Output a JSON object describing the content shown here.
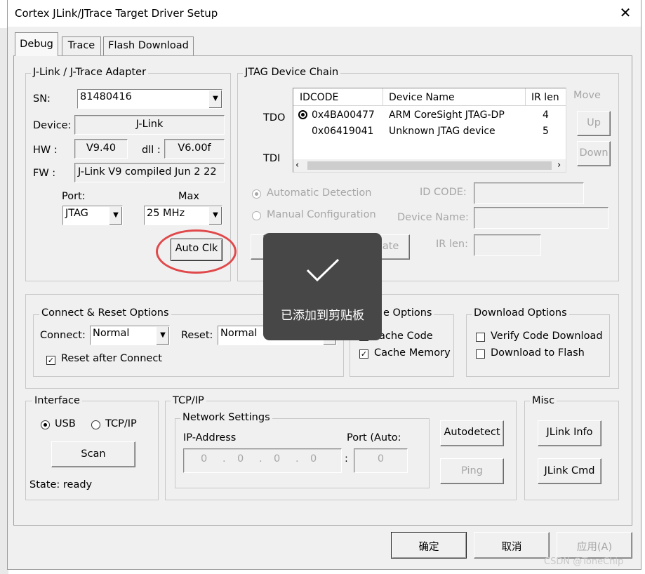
{
  "window": {
    "title": "Cortex JLink/JTrace Target Driver Setup",
    "close_glyph": "✕"
  },
  "tabs": [
    {
      "label": "Debug"
    },
    {
      "label": "Trace"
    },
    {
      "label": "Flash Download"
    }
  ],
  "adapter": {
    "title": "J-Link / J-Trace Adapter",
    "sn_label": "SN:",
    "sn_value": "81480416",
    "device_label": "Device:",
    "device_value": "J-Link",
    "hw_label": "HW :",
    "hw_value": "V9.40",
    "dll_label": "dll :",
    "dll_value": "V6.00f",
    "fw_label": "FW :",
    "fw_value": "J-Link V9 compiled Jun  2 22",
    "port_label": "Port:",
    "port_value": "JTAG",
    "max_label": "Max",
    "max_value": "25 MHz",
    "autoclk_label": "Auto Clk"
  },
  "jtag": {
    "title": "JTAG Device Chain",
    "tdo_label": "TDO",
    "tdi_label": "TDI",
    "columns": [
      "IDCODE",
      "Device Name",
      "IR len"
    ],
    "rows": [
      {
        "idcode": "0x4BA00477",
        "name": "ARM CoreSight JTAG-DP",
        "irlen": "4"
      },
      {
        "idcode": "0x06419041",
        "name": "Unknown JTAG device",
        "irlen": "5"
      }
    ],
    "move_label": "Move",
    "up_label": "Up",
    "down_label": "Down",
    "auto_detect_label": "Automatic Detection",
    "manual_config_label": "Manual Configuration",
    "idcode_label": "ID CODE:",
    "device_name_label": "Device Name:",
    "irlen_label": "IR len:",
    "update_label": "date"
  },
  "toast": {
    "text": "已添加到剪贴板"
  },
  "connect": {
    "title": "Connect & Reset Options",
    "connect_label": "Connect:",
    "connect_value": "Normal",
    "reset_label": "Reset:",
    "reset_value": "Normal",
    "reset_after_label": "Reset after Connect"
  },
  "cache": {
    "title": "e Options",
    "cache_code_label": "ache Code",
    "cache_memory_label": "Cache Memory"
  },
  "download": {
    "title": "Download Options",
    "verify_label": "Verify Code Download",
    "flash_label": "Download to Flash"
  },
  "interface": {
    "title": "Interface",
    "usb_label": "USB",
    "tcpip_label": "TCP/IP",
    "scan_label": "Scan",
    "state_label": "State: ready"
  },
  "tcp": {
    "title": "TCP/IP",
    "network_title": "Network Settings",
    "ip_label": "IP-Address",
    "port_label": "Port (Auto:",
    "ip": [
      "0",
      "0",
      "0",
      "0"
    ],
    "port_value": "0",
    "autodetect_label": "Autodetect",
    "ping_label": "Ping"
  },
  "misc": {
    "title": "Misc",
    "jlink_info_label": "JLink Info",
    "jlink_cmd_label": "JLink Cmd"
  },
  "footer": {
    "ok_label": "确定",
    "cancel_label": "取消",
    "apply_label": "应用(A)"
  },
  "watermark": "CSDN @ToneChip",
  "colors": {
    "highlight_circle": "#e0494b",
    "toast_bg": "#474747"
  }
}
